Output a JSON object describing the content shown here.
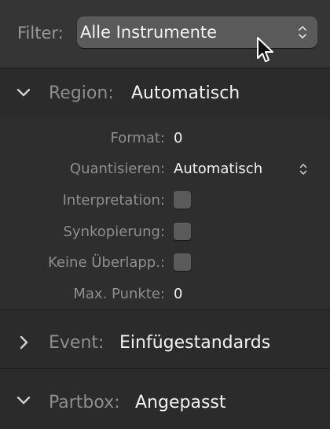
{
  "filter": {
    "label": "Filter:",
    "value": "Alle Instrumente"
  },
  "sections": {
    "region": {
      "label": "Region:",
      "value": "Automatisch",
      "expanded": true
    },
    "event": {
      "label": "Event:",
      "value": "Einfügestandards",
      "expanded": false
    },
    "partbox": {
      "label": "Partbox:",
      "value": "Angepasst",
      "expanded": true
    }
  },
  "region_params": {
    "format": {
      "label": "Format:",
      "value": "0"
    },
    "quantize": {
      "label": "Quantisieren:",
      "value": "Automatisch"
    },
    "interpretation": {
      "label": "Interpretation:",
      "checked": false
    },
    "syncopation": {
      "label": "Synkopierung:",
      "checked": false
    },
    "no_overlap": {
      "label": "Keine Überlapp.:",
      "checked": false
    },
    "max_dots": {
      "label": "Max. Punkte:",
      "value": "0"
    }
  },
  "icons": {
    "updown": "updown-chevrons-icon",
    "expand": "chevron-down-icon",
    "collapse": "chevron-right-icon",
    "cursor": "mouse-pointer-icon"
  }
}
